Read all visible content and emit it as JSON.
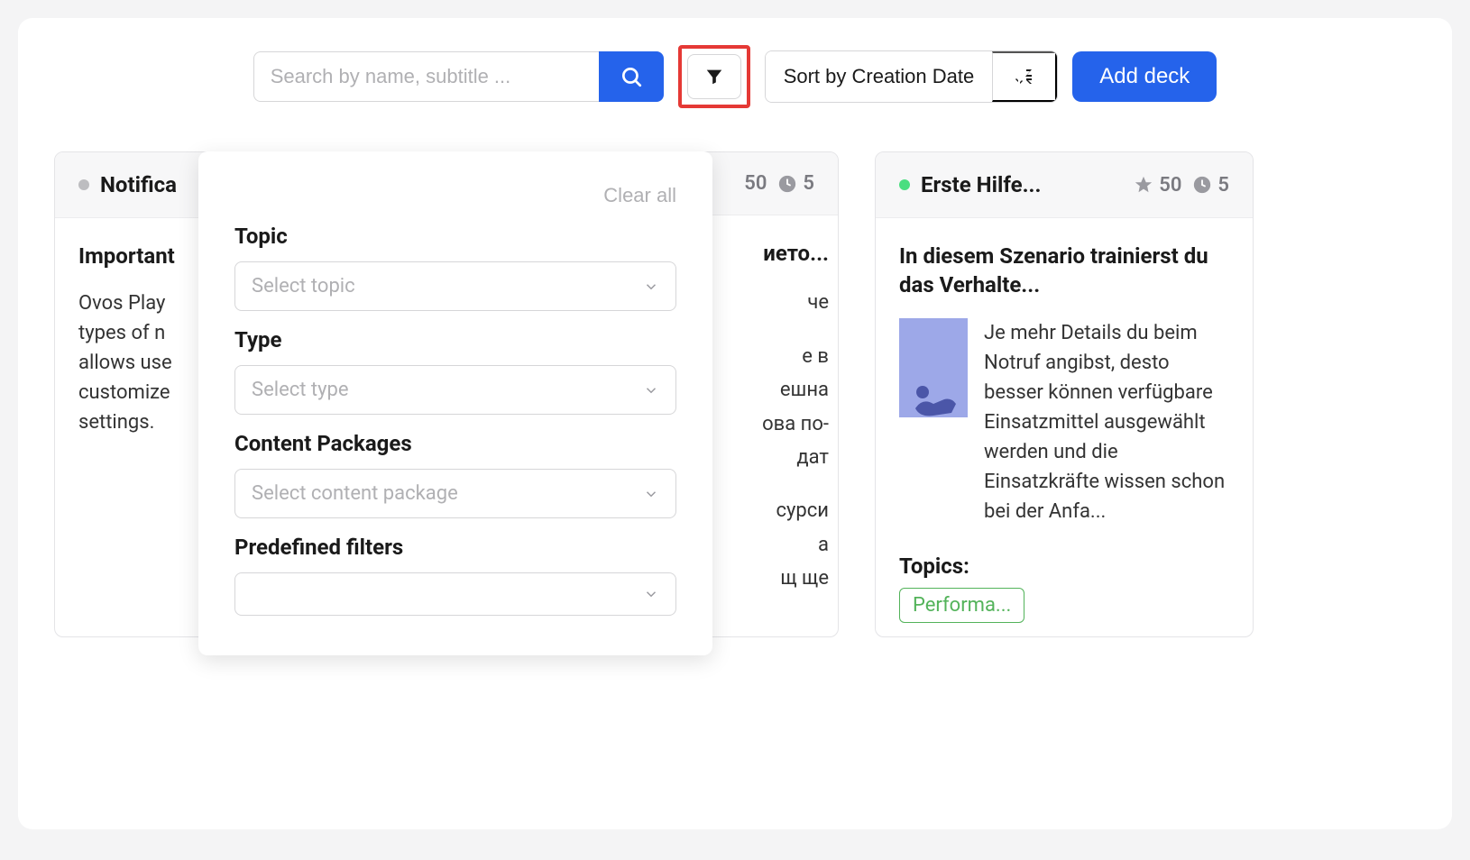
{
  "toolbar": {
    "search_placeholder": "Search by name, subtitle ...",
    "sort_label": "Sort by Creation Date",
    "add_button": "Add deck"
  },
  "filter_popover": {
    "clear_all": "Clear all",
    "topic_label": "Topic",
    "topic_placeholder": "Select topic",
    "type_label": "Type",
    "type_placeholder": "Select type",
    "packages_label": "Content Packages",
    "packages_placeholder": "Select content package",
    "predefined_label": "Predefined filters",
    "predefined_placeholder": ""
  },
  "cards": [
    {
      "status": "gray",
      "title": "Notifica",
      "subtitle": "Important",
      "body": "Ovos Play\ntypes of n\nallows use\ncustomize\nsettings."
    },
    {
      "status": "gray",
      "stat_star": "50",
      "stat_clock": "5",
      "subtitle_frag": "ието...",
      "lines": [
        "че",
        "е в",
        "ешна",
        "ова по-",
        "дат",
        "сурси",
        "а",
        "щ ще"
      ]
    },
    {
      "status": "green",
      "title": "Erste Hilfe...",
      "stat_star": "50",
      "stat_clock": "5",
      "subtitle": "In diesem Szenario trainierst du das Verhalte...",
      "body": "Je mehr Details du beim Notruf angibst, desto besser können verfügbare Einsatzmittel ausgewählt werden und die Einsatzkräfte wissen schon bei der Anfa...",
      "topics_label": "Topics:",
      "tag": "Performa..."
    }
  ]
}
